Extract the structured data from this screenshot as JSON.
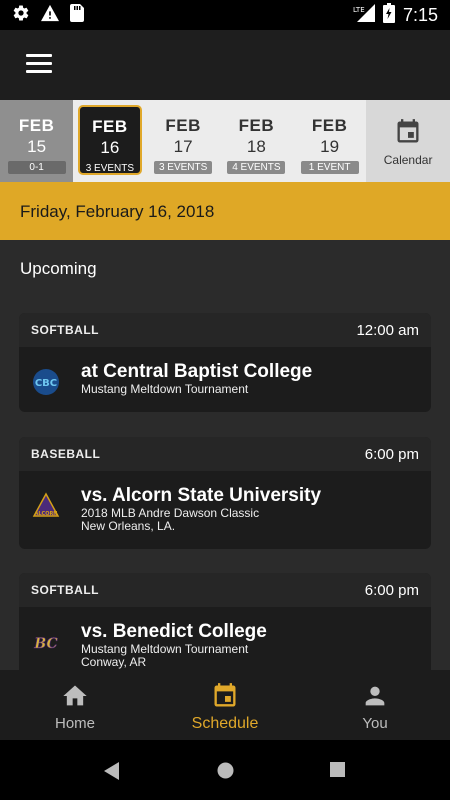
{
  "status": {
    "time": "7:15",
    "network": "LTE"
  },
  "dates": [
    {
      "month": "FEB",
      "day": "15",
      "badge": "0-1",
      "state": "past"
    },
    {
      "month": "FEB",
      "day": "16",
      "badge": "3 EVENTS",
      "state": "selected"
    },
    {
      "month": "FEB",
      "day": "17",
      "badge": "3 EVENTS",
      "state": "normal"
    },
    {
      "month": "FEB",
      "day": "18",
      "badge": "4 EVENTS",
      "state": "normal"
    },
    {
      "month": "FEB",
      "day": "19",
      "badge": "1 EVENT",
      "state": "normal"
    }
  ],
  "calendar_label": "Calendar",
  "selected_date": "Friday, February 16, 2018",
  "section_label": "Upcoming",
  "events": [
    {
      "sport": "SOFTBALL",
      "time": "12:00 am",
      "opponent": "at Central Baptist College",
      "line1": "Mustang Meltdown Tournament",
      "line2": "",
      "logo_text": "CBC"
    },
    {
      "sport": "BASEBALL",
      "time": "6:00 pm",
      "opponent": "vs. Alcorn State University",
      "line1": "2018 MLB Andre Dawson Classic",
      "line2": "New Orleans, LA.",
      "logo_text": "ALCORN"
    },
    {
      "sport": "SOFTBALL",
      "time": "6:00 pm",
      "opponent": "vs. Benedict College",
      "line1": "Mustang Meltdown Tournament",
      "line2": "Conway, AR",
      "logo_text": "BC"
    }
  ],
  "nav": {
    "home": "Home",
    "schedule": "Schedule",
    "you": "You"
  },
  "colors": {
    "accent": "#dfa826",
    "background": "#2b2b2b",
    "card": "#1c1c1c"
  }
}
